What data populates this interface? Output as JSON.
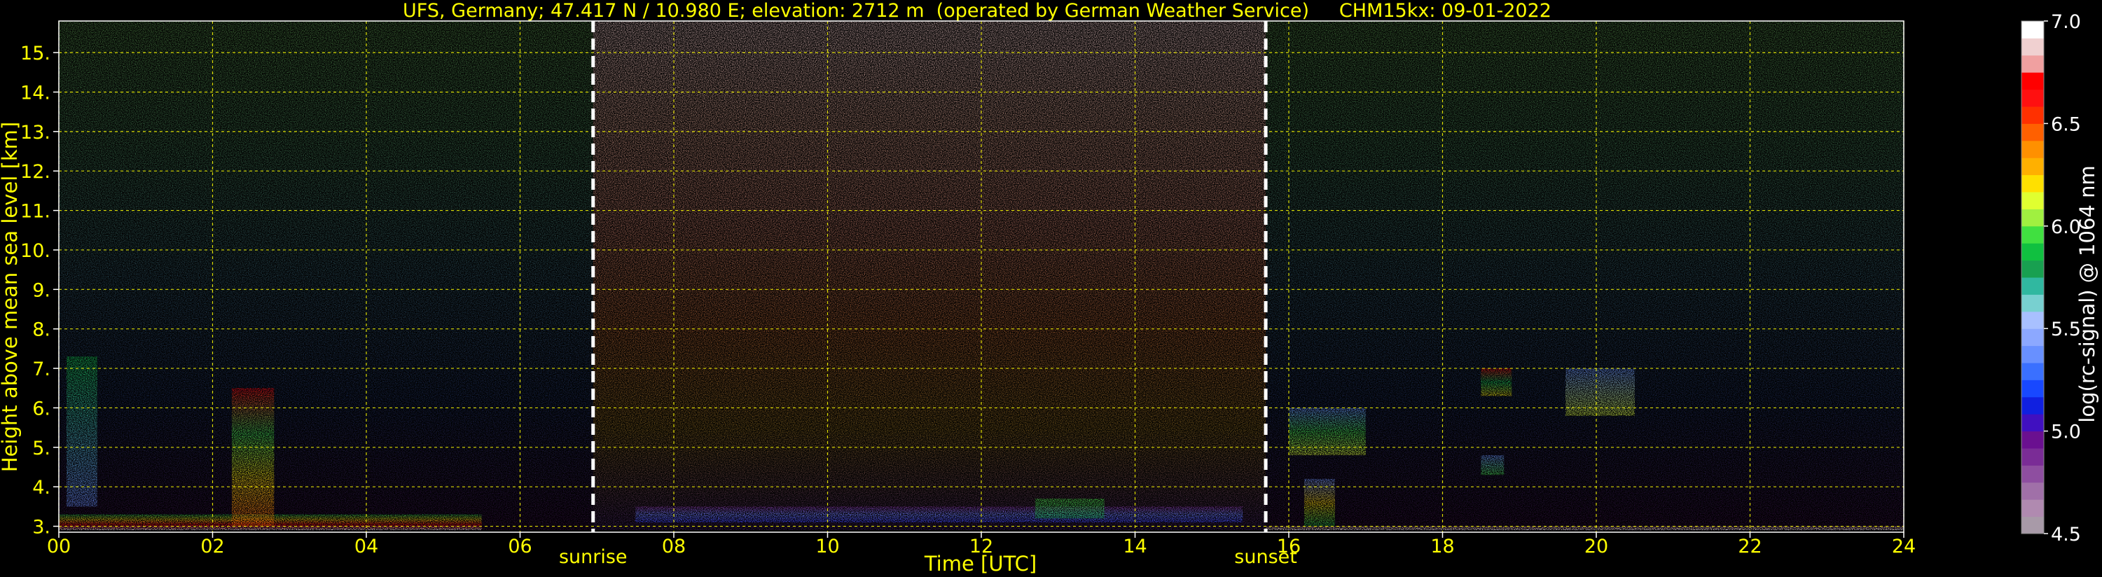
{
  "chart_data": {
    "type": "heatmap",
    "title": "UFS, Germany; 47.417 N / 10.980 E; elevation: 2712 m  (operated by German Weather Service)     CHM15kx: 09-01-2022",
    "xlabel": "Time [UTC]",
    "ylabel": "Height above mean sea level [km]",
    "xlim": [
      0,
      24
    ],
    "ylim": [
      2.85,
      15.8
    ],
    "x_ticks": [
      "00",
      "02",
      "04",
      "06",
      "08",
      "10",
      "12",
      "14",
      "16",
      "18",
      "20",
      "22",
      "24"
    ],
    "y_ticks": [
      "3.",
      "4.",
      "5.",
      "6.",
      "7.",
      "8.",
      "9.",
      "10.",
      "11.",
      "12.",
      "13.",
      "14.",
      "15."
    ],
    "grid": true,
    "events": [
      {
        "label": "sunrise",
        "x": 6.95
      },
      {
        "label": "sunset",
        "x": 15.7
      }
    ],
    "colorbar": {
      "label": "log(rc-signal) @ 1064 nm",
      "range": [
        4.5,
        7.0
      ],
      "ticks": [
        "4.5",
        "5.0",
        "5.5",
        "6.0",
        "6.5",
        "7.0"
      ],
      "colors": [
        "#a89aa8",
        "#b08ab0",
        "#a070a8",
        "#8e4ea0",
        "#7a2c96",
        "#6a1090",
        "#4010c0",
        "#1020e0",
        "#1848ff",
        "#3a70ff",
        "#6890ff",
        "#8ca8ff",
        "#a8c0ff",
        "#78d0d0",
        "#30b8a0",
        "#18a050",
        "#10c040",
        "#40e040",
        "#a0f040",
        "#e0ff30",
        "#ffe000",
        "#ffb000",
        "#ff9000",
        "#ff6000",
        "#ff3000",
        "#ff1010",
        "#ff0000",
        "#f0a0a0",
        "#f0d0d0",
        "#ffffff"
      ]
    },
    "layers": [
      {
        "name": "night background",
        "x": [
          0,
          6.95
        ],
        "y": [
          2.9,
          15.8
        ],
        "colors": [
          "#30103a",
          "#1c2850",
          "#2a4a58",
          "#3a6a4a",
          "#4a7a40"
        ]
      },
      {
        "name": "daylight background",
        "x": [
          6.95,
          15.7
        ],
        "y": [
          2.9,
          15.8
        ],
        "colors": [
          "#402060",
          "#806020",
          "#a05a30",
          "#b07060",
          "#c09080",
          "#d0b0b0"
        ]
      },
      {
        "name": "night background",
        "x": [
          15.7,
          24
        ],
        "y": [
          2.9,
          15.8
        ],
        "colors": [
          "#30103a",
          "#1c2850",
          "#2a4a58",
          "#3a6a4a",
          "#4a7a40"
        ]
      },
      {
        "name": "daytime boundary layer",
        "x": [
          7.5,
          15.4
        ],
        "y": [
          3.1,
          3.5
        ],
        "colors": [
          "#3040ff",
          "#6080ff",
          "#7a2c96"
        ]
      },
      {
        "name": "aerosol patch",
        "x": [
          12.7,
          13.6
        ],
        "y": [
          3.2,
          3.7
        ],
        "colors": [
          "#10c040",
          "#40e040"
        ]
      },
      {
        "name": "surface layer",
        "x": [
          0,
          5.5
        ],
        "y": [
          2.9,
          3.3
        ],
        "colors": [
          "#ffffff",
          "#ff0000",
          "#ffe000",
          "#10c040"
        ]
      },
      {
        "name": "cloud",
        "x": [
          2.25,
          2.8
        ],
        "y": [
          3.0,
          6.5
        ],
        "colors": [
          "#ff6000",
          "#ffe000",
          "#40e040",
          "#ff0000"
        ]
      },
      {
        "name": "cloud",
        "x": [
          0.1,
          0.5
        ],
        "y": [
          3.5,
          7.3
        ],
        "colors": [
          "#6890ff",
          "#10c040"
        ]
      },
      {
        "name": "cloud",
        "x": [
          16.2,
          16.6
        ],
        "y": [
          3.0,
          4.2
        ],
        "colors": [
          "#10c040",
          "#ffe000",
          "#6890ff"
        ]
      },
      {
        "name": "cloud",
        "x": [
          16.0,
          17.0
        ],
        "y": [
          4.8,
          6.0
        ],
        "colors": [
          "#e0ff30",
          "#40e040",
          "#6890ff"
        ]
      },
      {
        "name": "cloud",
        "x": [
          18.5,
          18.9
        ],
        "y": [
          6.3,
          7.0
        ],
        "colors": [
          "#ffe000",
          "#10c040",
          "#ff0000"
        ]
      },
      {
        "name": "cloud",
        "x": [
          19.6,
          20.5
        ],
        "y": [
          5.8,
          7.0
        ],
        "colors": [
          "#e0ff30",
          "#6890ff"
        ]
      },
      {
        "name": "cloud",
        "x": [
          18.5,
          18.8
        ],
        "y": [
          4.3,
          4.8
        ],
        "colors": [
          "#40e040",
          "#6890ff"
        ]
      },
      {
        "name": "surface layer",
        "x": [
          15.7,
          24
        ],
        "y": [
          2.9,
          3.0
        ],
        "colors": [
          "#ffffff",
          "#c09080"
        ]
      }
    ]
  }
}
